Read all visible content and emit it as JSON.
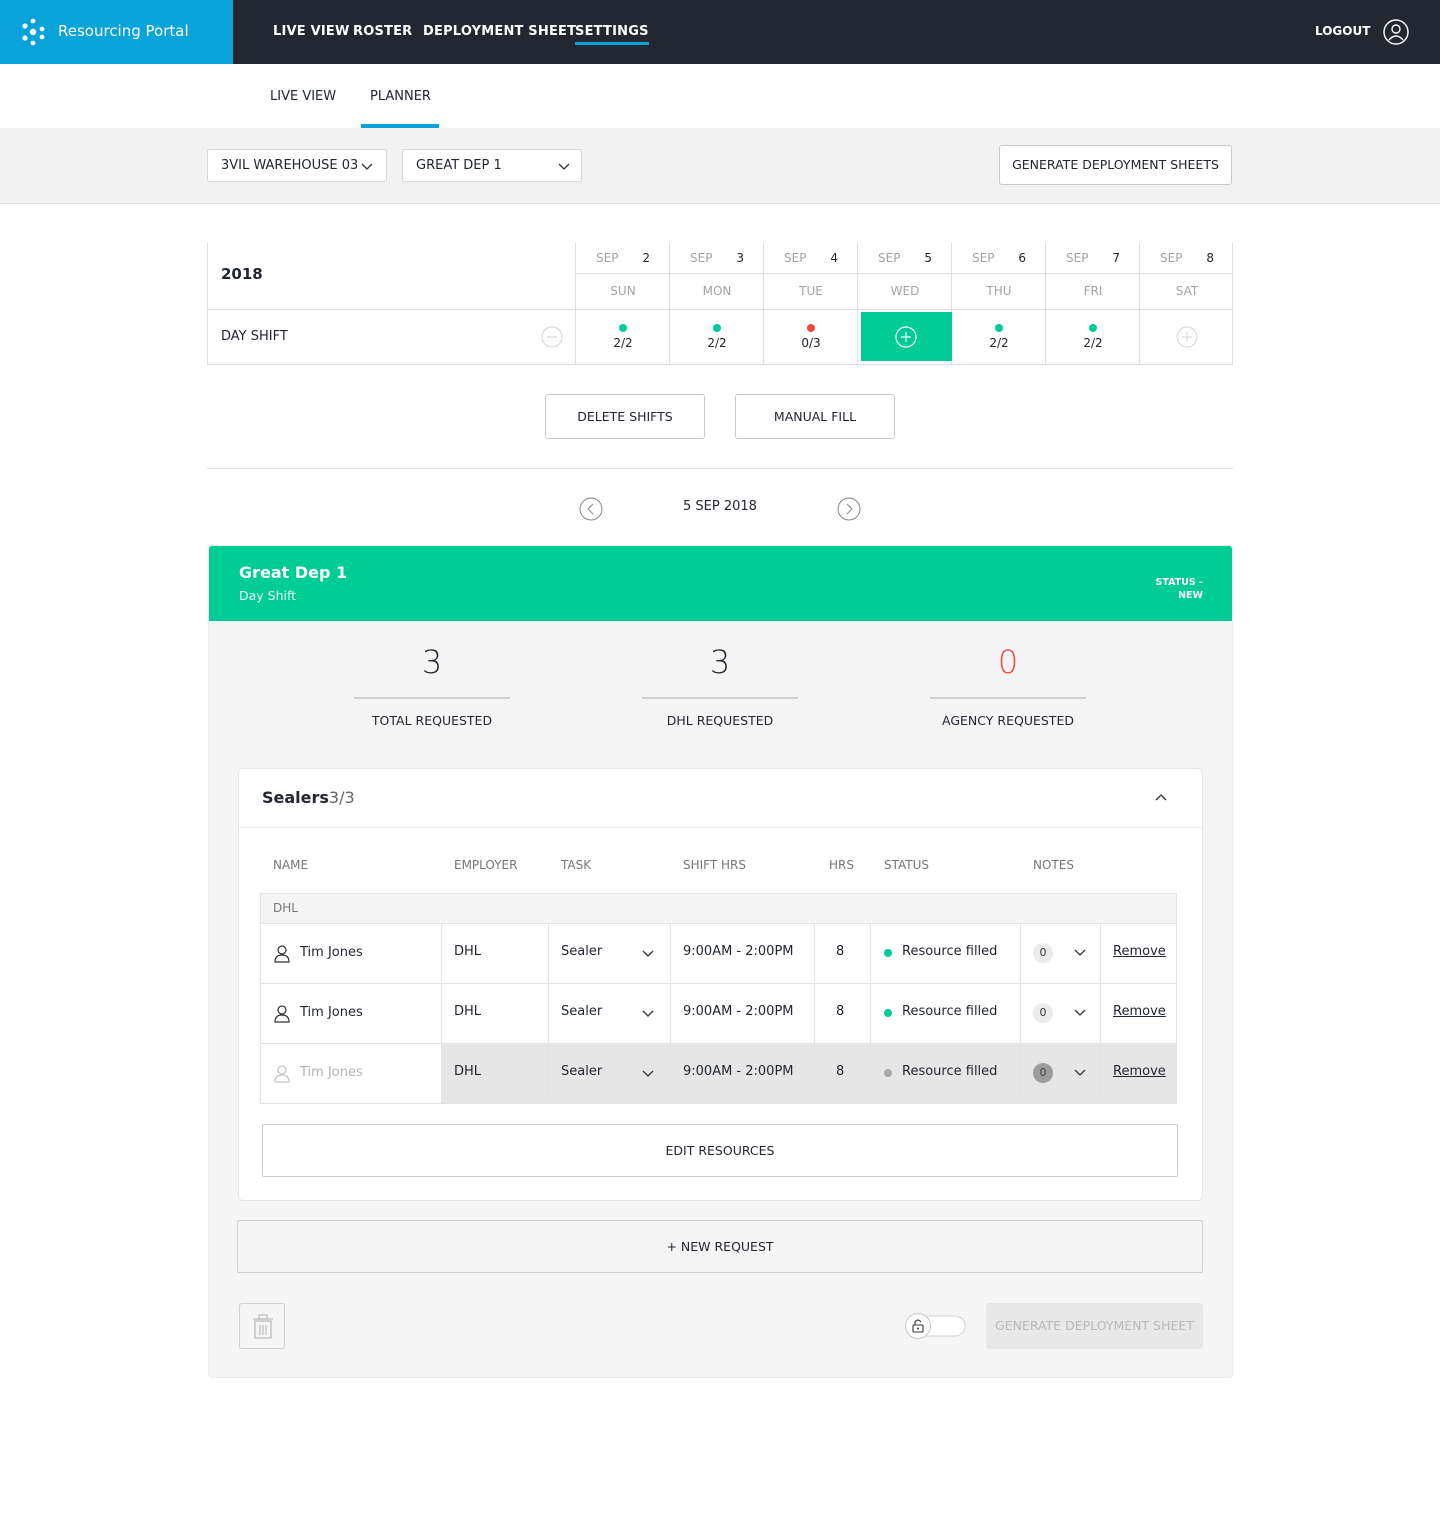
{
  "brand": {
    "name": "Resourcing Portal"
  },
  "nav": {
    "items": [
      {
        "label": "LIVE VIEW"
      },
      {
        "label": "ROSTER"
      },
      {
        "label": "DEPLOYMENT SHEET"
      },
      {
        "label": "SETTINGS",
        "active": true
      }
    ],
    "logout": "LOGOUT"
  },
  "subtabs": [
    {
      "label": "LIVE VIEW"
    },
    {
      "label": "PLANNER",
      "active": true
    }
  ],
  "filters": {
    "site": "3VIL WAREHOUSE 03",
    "department": "GREAT DEP 1",
    "generate_label": "GENERATE DEPLOYMENT SHEETS"
  },
  "calendar": {
    "year": "2018",
    "days": [
      {
        "month": "SEP",
        "num": "2",
        "dow": "SUN",
        "count": "2/2",
        "status": "ok"
      },
      {
        "month": "SEP",
        "num": "3",
        "dow": "MON",
        "count": "2/2",
        "status": "ok"
      },
      {
        "month": "SEP",
        "num": "4",
        "dow": "TUE",
        "count": "0/3",
        "status": "short"
      },
      {
        "month": "SEP",
        "num": "5",
        "dow": "WED",
        "count": "",
        "status": "selected"
      },
      {
        "month": "SEP",
        "num": "6",
        "dow": "THU",
        "count": "2/2",
        "status": "ok"
      },
      {
        "month": "SEP",
        "num": "7",
        "dow": "FRI",
        "count": "2/2",
        "status": "ok"
      },
      {
        "month": "SEP",
        "num": "8",
        "dow": "SAT",
        "count": "",
        "status": "empty"
      }
    ],
    "shift_label": "DAY SHIFT"
  },
  "actions": {
    "delete": "DELETE SHIFTS",
    "manual": "MANUAL FILL"
  },
  "date_nav": {
    "label": "5 SEP 2018"
  },
  "panel": {
    "title": "Great Dep 1",
    "subtitle": "Day Shift",
    "status_line1": "STATUS -",
    "status_line2": "NEW",
    "stats": [
      {
        "value": "3",
        "label": "TOTAL REQUESTED",
        "color": "#222630"
      },
      {
        "value": "3",
        "label": "DHL REQUESTED",
        "color": "#222630"
      },
      {
        "value": "0",
        "label": "AGENCY REQUESTED",
        "color": "#f0473f"
      }
    ],
    "card": {
      "title": "Sealers",
      "count": "3/3",
      "headers": [
        "NAME",
        "EMPLOYER",
        "TASK",
        "SHIFT HRS",
        "HRS",
        "STATUS",
        "NOTES"
      ],
      "group": "DHL",
      "rows": [
        {
          "name": "Tim Jones",
          "employer": "DHL",
          "task": "Sealer",
          "shift": "9:00AM - 2:00PM",
          "hrs": "8",
          "status": "Resource filled",
          "notes": "0",
          "action": "Remove"
        },
        {
          "name": "Tim Jones",
          "employer": "DHL",
          "task": "Sealer",
          "shift": "9:00AM - 2:00PM",
          "hrs": "8",
          "status": "Resource filled",
          "notes": "0",
          "action": "Remove"
        },
        {
          "name": "Tim Jones",
          "employer": "DHL",
          "task": "Sealer",
          "shift": "9:00AM - 2:00PM",
          "hrs": "8",
          "status": "Resource filled",
          "notes": "0",
          "action": "Remove",
          "disabled": true
        }
      ],
      "edit_label": "EDIT RESOURCES"
    },
    "new_request": "+ NEW REQUEST",
    "generate_sheet": "GENERATE DEPLOYMENT SHEET"
  },
  "colors": {
    "accent_blue": "#08a3d8",
    "accent_green": "#00cc96",
    "danger": "#f0473f",
    "topbar": "#232732"
  },
  "icons": [
    "brand-logo-icon",
    "user-icon",
    "chevron-down-icon",
    "minus-circle-icon",
    "plus-circle-icon",
    "chevron-left-icon",
    "chevron-right-icon",
    "chevron-up-icon",
    "person-icon",
    "trash-icon",
    "lock-icon"
  ]
}
